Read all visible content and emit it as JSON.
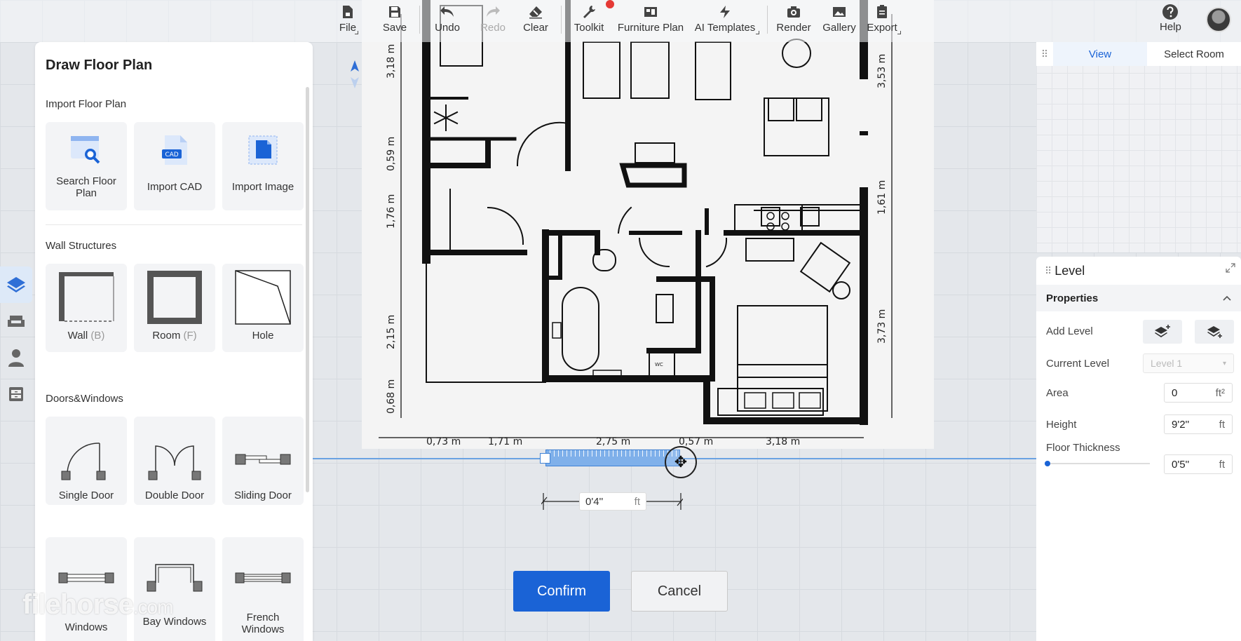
{
  "toolbar": {
    "items": [
      {
        "label": "File",
        "icon": "file-icon"
      },
      {
        "label": "Save",
        "icon": "save-icon"
      },
      {
        "label": "Undo",
        "icon": "undo-icon"
      },
      {
        "label": "Redo",
        "icon": "redo-icon"
      },
      {
        "label": "Clear",
        "icon": "eraser-icon"
      },
      {
        "label": "Toolkit",
        "icon": "wrench-icon"
      },
      {
        "label": "Furniture Plan",
        "icon": "furniture-plan-icon"
      },
      {
        "label": "AI Templates",
        "icon": "ai-templates-icon"
      },
      {
        "label": "Render",
        "icon": "render-icon"
      },
      {
        "label": "Gallery",
        "icon": "gallery-icon"
      },
      {
        "label": "Export",
        "icon": "export-icon"
      }
    ],
    "help_label": "Help"
  },
  "panel": {
    "title": "Draw Floor Plan",
    "import_section": "Import Floor Plan",
    "import_tiles": [
      {
        "label": "Search Floor Plan"
      },
      {
        "label": "Import CAD",
        "icon_text": "CAD"
      },
      {
        "label": "Import Image"
      }
    ],
    "walls_section": "Wall Structures",
    "wall_tiles": [
      {
        "label": "Wall",
        "hint": "(B)"
      },
      {
        "label": "Room",
        "hint": "(F)"
      },
      {
        "label": "Hole",
        "hint": ""
      }
    ],
    "doors_section": "Doors&Windows",
    "door_tiles": [
      {
        "label": "Single Door"
      },
      {
        "label": "Double Door"
      },
      {
        "label": "Sliding Door"
      },
      {
        "label": "Windows"
      },
      {
        "label": "Bay Windows"
      },
      {
        "label": "French Windows"
      }
    ]
  },
  "plan": {
    "left_dims": [
      "3,18 m",
      "0,59 m",
      "1,76 m",
      "2,15 m",
      "0,68 m"
    ],
    "right_dims": [
      "3,53 m",
      "1,61 m",
      "3,73 m"
    ],
    "bottom_dims": [
      "0,73 m",
      "1,71 m",
      "2,75 m",
      "0,57 m",
      "3,18 m"
    ],
    "wc_label": "WC"
  },
  "measure": {
    "value": "0'4''",
    "unit": "ft"
  },
  "actions": {
    "confirm": "Confirm",
    "cancel": "Cancel"
  },
  "watermark": {
    "name": "filehorse",
    "suffix": ".com"
  },
  "view": {
    "tabs": [
      "View",
      "Select Room"
    ]
  },
  "level": {
    "title": "Level",
    "properties": "Properties",
    "add_level": "Add Level",
    "current_level_label": "Current Level",
    "current_level_value": "Level 1",
    "area_label": "Area",
    "area_value": "0",
    "area_unit": "ft²",
    "height_label": "Height",
    "height_value": "9'2''",
    "height_unit": "ft",
    "floor_thickness_label": "Floor Thickness",
    "floor_thickness_value": "0'5''",
    "floor_thickness_unit": "ft",
    "floor_thickness_slider": 0.0
  },
  "colors": {
    "accent": "#1a63d6",
    "ruler": "#7fb0ea",
    "notification": "#e53935"
  }
}
